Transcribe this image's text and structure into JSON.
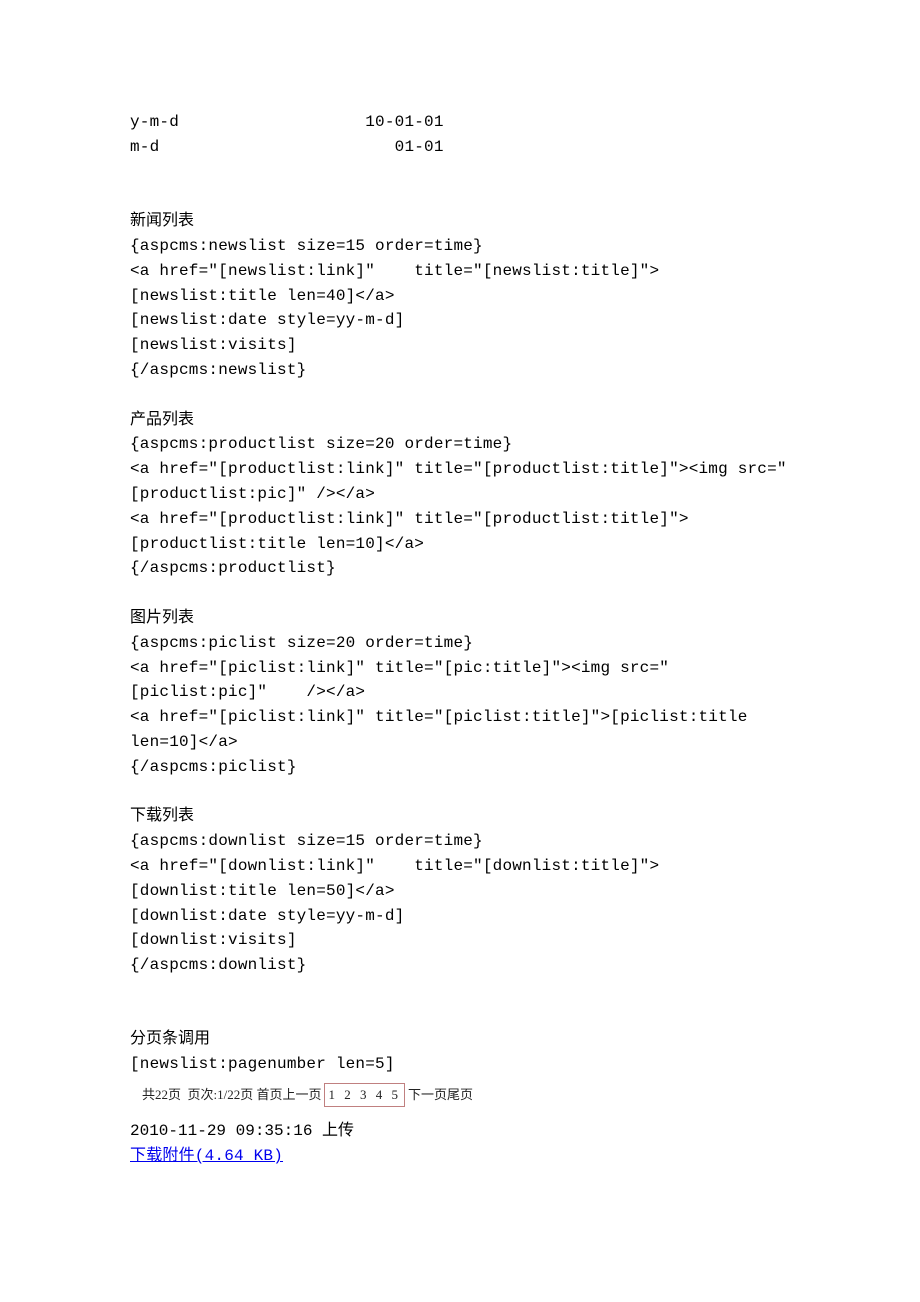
{
  "date_formats": {
    "line1_fmt": "y-m-d",
    "line1_ex": "10-01-01",
    "line2_fmt": "m-d",
    "line2_ex": "01-01"
  },
  "sections": {
    "news_title": "新闻列表",
    "news_code": "{aspcms:newslist size=15 order=time}\n<a href=\"[newslist:link]\"    title=\"[newslist:title]\">[newslist:title len=40]</a>\n[newslist:date style=yy-m-d]\n[newslist:visits]\n{/aspcms:newslist}",
    "product_title": "产品列表",
    "product_code": "{aspcms:productlist size=20 order=time}\n<a href=\"[productlist:link]\" title=\"[productlist:title]\"><img src=\"[productlist:pic]\" /></a>\n<a href=\"[productlist:link]\" title=\"[productlist:title]\">[productlist:title len=10]</a>\n{/aspcms:productlist}",
    "pic_title": "图片列表",
    "pic_code": "{aspcms:piclist size=20 order=time}\n<a href=\"[piclist:link]\" title=\"[pic:title]\"><img src=\"[piclist:pic]\"    /></a>\n<a href=\"[piclist:link]\" title=\"[piclist:title]\">[piclist:title len=10]</a>\n{/aspcms:piclist}",
    "down_title": "下载列表",
    "down_code": "{aspcms:downlist size=15 order=time}\n<a href=\"[downlist:link]\"    title=\"[downlist:title]\">[downlist:title len=50]</a>\n[downlist:date style=yy-m-d]\n[downlist:visits]\n{/aspcms:downlist}",
    "pager_title": "分页条调用",
    "pager_code": "[newslist:pagenumber len=5]"
  },
  "pager_preview": {
    "prefix": "共22页  页次:1/22页 首页上一页",
    "numbers": "1 2 3 4 5",
    "suffix": "下一页尾页"
  },
  "upload": {
    "timestamp": "2010-11-29 09:35:16 上传",
    "link_text": "下载附件(4.64 KB)"
  }
}
